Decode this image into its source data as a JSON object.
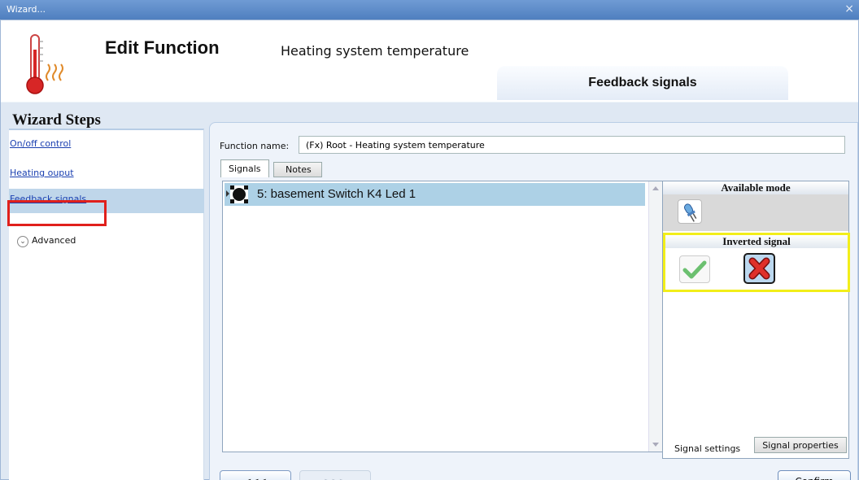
{
  "window": {
    "title": "Wizard...",
    "close_glyph": "×"
  },
  "header": {
    "title": "Edit Function",
    "subtitle": "Heating system temperature",
    "section_tab": "Feedback signals",
    "icon": "thermometer-heating-icon"
  },
  "wizard_steps": {
    "title": "Wizard Steps",
    "items": [
      {
        "label": "On/off control",
        "active": false
      },
      {
        "label": "Heating ouput",
        "active": false
      },
      {
        "label": "Feedback signals",
        "active": true
      }
    ],
    "advanced_label": "Advanced",
    "highlight_color": "#e0201c"
  },
  "form": {
    "function_name_label": "Function name:",
    "function_name_value": "(Fx) Root - Heating system temperature"
  },
  "tabs": {
    "signals": "Signals",
    "notes": "Notes",
    "active": "Signals"
  },
  "signals": [
    {
      "label": "5: basement Switch K4 Led 1",
      "icon": "led-signal-icon",
      "selected": true
    }
  ],
  "right_panel": {
    "available_mode_title": "Available mode",
    "available_mode_icon": "led-bulb-icon",
    "inverted_signal_title": "Inverted signal",
    "inverted_options": [
      {
        "icon": "check-icon",
        "selected": false
      },
      {
        "icon": "x-icon",
        "selected": true
      }
    ],
    "highlight_color": "#f2ee1a",
    "tab_signal_settings": "Signal settings",
    "tab_signal_properties": "Signal properties"
  },
  "nav": {
    "back": "<<<",
    "next": ">>>",
    "confirm": "Confirm"
  }
}
